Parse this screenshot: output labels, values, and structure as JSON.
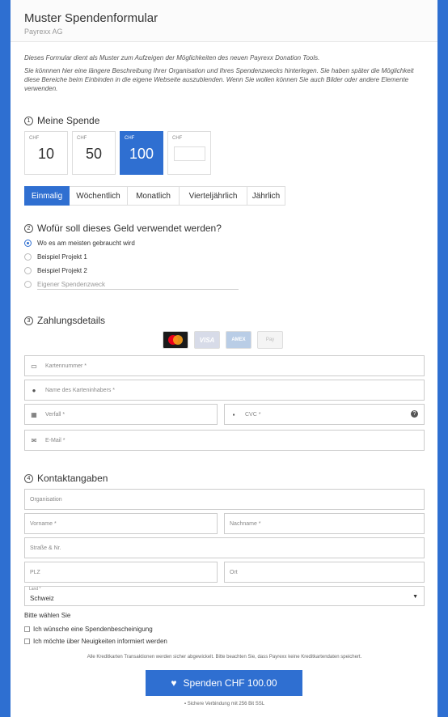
{
  "header": {
    "title": "Muster Spendenformular",
    "subtitle": "Payrexx AG"
  },
  "intro": {
    "p1": "Dieses Formular dient als Muster zum Aufzeigen der Möglichkeiten des neuen Payrexx Donation Tools.",
    "p2": "Sie könnnen hier eine längere Beschreibung Ihrer Organisation und Ihres Spendenzwecks hinterlegen. Sie haben später die Möglichkeit diese Bereiche beim Einbinden in die eigene Webseite auszublenden. Wenn Sie wollen können Sie auch Bilder oder andere Elemente verwenden."
  },
  "donation": {
    "num": "1",
    "title": "Meine Spende",
    "currency": "CHF",
    "amounts": [
      "10",
      "50",
      "100"
    ],
    "selected_amount": "100",
    "frequencies": [
      "Einmalig",
      "Wöchentlich",
      "Monatlich",
      "Vierteljährlich",
      "Jährlich"
    ],
    "selected_frequency": "Einmalig"
  },
  "purpose": {
    "num": "2",
    "title": "Wofür soll dieses Geld verwendet werden?",
    "options": [
      "Wo es am meisten gebraucht wird",
      "Beispiel Projekt 1",
      "Beispiel Projekt 2"
    ],
    "custom_placeholder": "Eigener Spendenzweck",
    "selected": "Wo es am meisten gebraucht wird"
  },
  "payment": {
    "num": "3",
    "title": "Zahlungsdetails",
    "card_brands": [
      "Mastercard",
      "VISA",
      "AMEX",
      "Pay"
    ],
    "fields": {
      "card_number": "Kartennummer *",
      "card_holder": "Name des Karteninhabers *",
      "expiry": "Verfall *",
      "cvc": "CVC *",
      "email": "E-Mail *"
    },
    "help": "?"
  },
  "contact": {
    "num": "4",
    "title": "Kontaktangaben",
    "fields": {
      "organisation": "Organisation",
      "firstname": "Vorname *",
      "lastname": "Nachname *",
      "street": "Straße & Nr.",
      "zip": "PLZ",
      "city": "Ort"
    },
    "country_label": "Land *",
    "country_value": "Schweiz",
    "choose_label": "Bitte wählen Sie",
    "checkboxes": [
      "Ich wünsche eine Spendenbescheinigung",
      "Ich möchte über Neuigkeiten informiert werden"
    ]
  },
  "footer": {
    "note": "Alle Kreditkarten Transaktionen werden sicher abgewickelt. Bitte beachten Sie, dass Payrexx keine Kreditkartendaten speichert.",
    "button": "Spenden  CHF 100.00",
    "secure": "Sichere Verbindung mit 256 Bit SSL"
  },
  "colors": {
    "accent": "#2f6fd1",
    "background": "#2e6fd1"
  }
}
